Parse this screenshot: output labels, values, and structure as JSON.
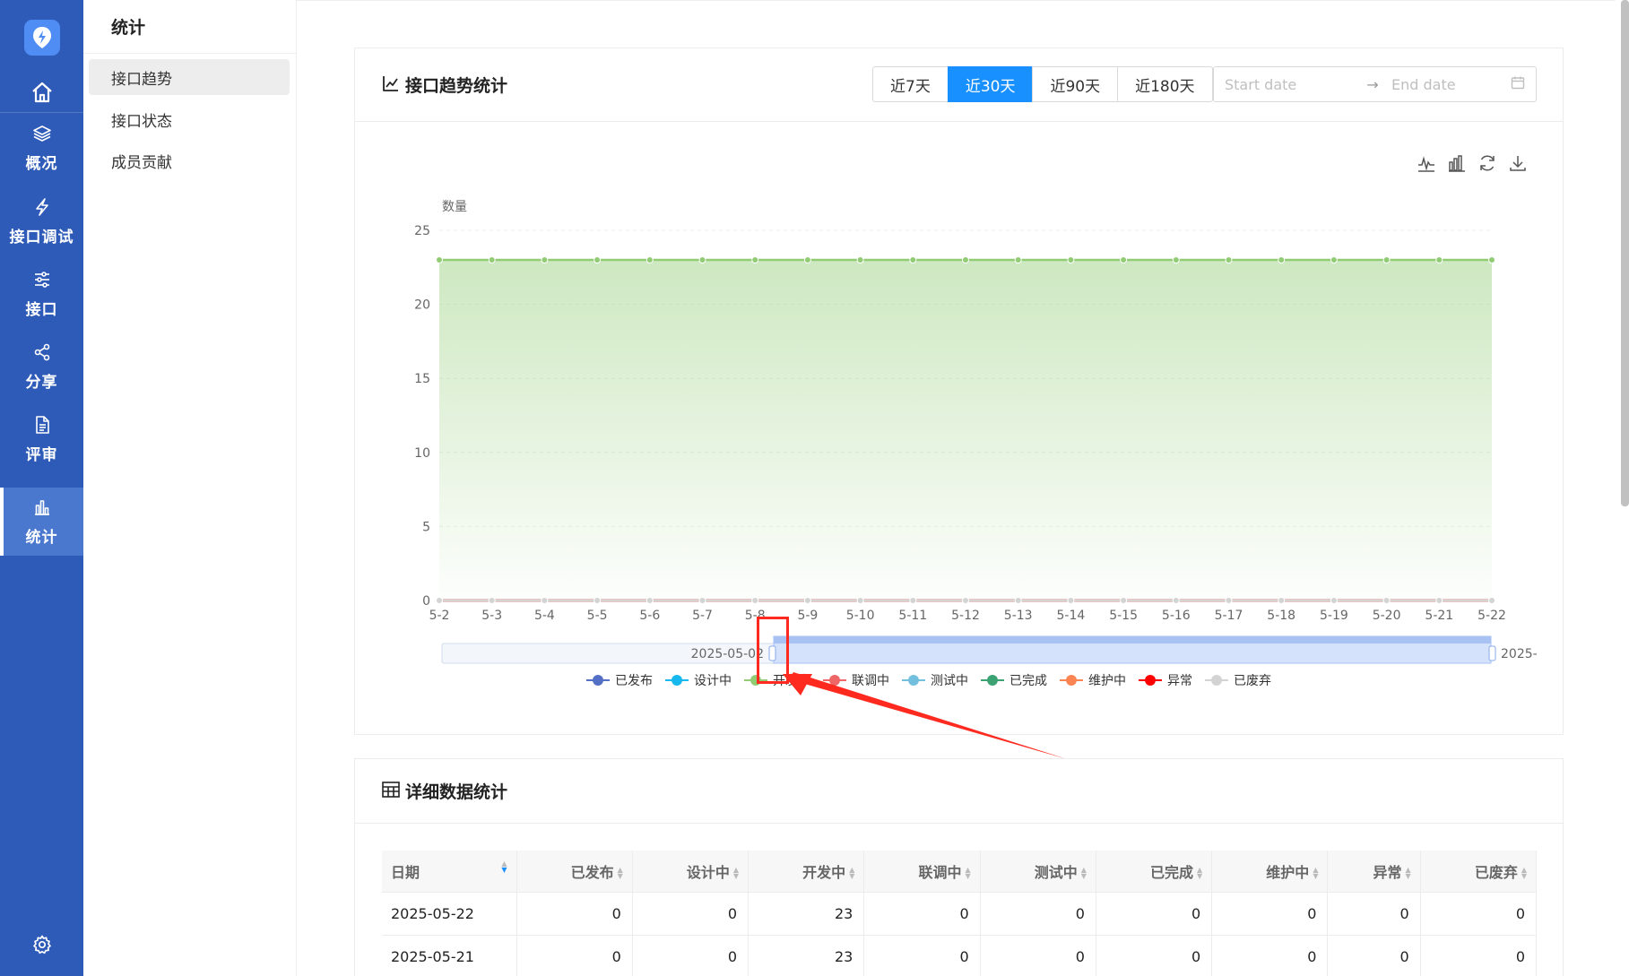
{
  "rail": {
    "items": [
      {
        "label": "概况",
        "icon": "layers-icon"
      },
      {
        "label": "接口调试",
        "icon": "lightning-icon"
      },
      {
        "label": "接口",
        "icon": "sliders-icon"
      },
      {
        "label": "分享",
        "icon": "share-icon"
      },
      {
        "label": "评审",
        "icon": "document-icon"
      },
      {
        "label": "统计",
        "icon": "bar-chart-icon"
      }
    ],
    "active_index": 5
  },
  "subnav": {
    "title": "统计",
    "items": [
      {
        "label": "接口趋势"
      },
      {
        "label": "接口状态"
      },
      {
        "label": "成员贡献"
      }
    ],
    "active_index": 0
  },
  "trend": {
    "title": "接口趋势统计",
    "ranges": [
      "近7天",
      "近30天",
      "近90天",
      "近180天"
    ],
    "active_range_index": 1,
    "date_start_placeholder": "Start date",
    "date_end_placeholder": "End date",
    "date_arrow": "→",
    "zoom_start_label": "2025-05-02",
    "zoom_end_label": "2025-"
  },
  "chart_data": {
    "type": "line",
    "title": "",
    "xlabel": "",
    "ylabel": "数量",
    "ylim": [
      0,
      25
    ],
    "yticks": [
      0,
      5,
      10,
      15,
      20,
      25
    ],
    "grid": true,
    "legend": "bottom",
    "categories": [
      "5-2",
      "5-3",
      "5-4",
      "5-5",
      "5-6",
      "5-7",
      "5-8",
      "5-9",
      "5-10",
      "5-11",
      "5-12",
      "5-13",
      "5-14",
      "5-15",
      "5-16",
      "5-17",
      "5-18",
      "5-19",
      "5-20",
      "5-21",
      "5-22"
    ],
    "series": [
      {
        "name": "已发布",
        "color": "#5470c6",
        "values": [
          0,
          0,
          0,
          0,
          0,
          0,
          0,
          0,
          0,
          0,
          0,
          0,
          0,
          0,
          0,
          0,
          0,
          0,
          0,
          0,
          0
        ]
      },
      {
        "name": "设计中",
        "color": "#16b8f0",
        "values": [
          0,
          0,
          0,
          0,
          0,
          0,
          0,
          0,
          0,
          0,
          0,
          0,
          0,
          0,
          0,
          0,
          0,
          0,
          0,
          0,
          0
        ]
      },
      {
        "name": "开发中",
        "color": "#91cc75",
        "area": true,
        "values": [
          23,
          23,
          23,
          23,
          23,
          23,
          23,
          23,
          23,
          23,
          23,
          23,
          23,
          23,
          23,
          23,
          23,
          23,
          23,
          23,
          23
        ]
      },
      {
        "name": "联调中",
        "color": "#ee6666",
        "values": [
          0,
          0,
          0,
          0,
          0,
          0,
          0,
          0,
          0,
          0,
          0,
          0,
          0,
          0,
          0,
          0,
          0,
          0,
          0,
          0,
          0
        ]
      },
      {
        "name": "测试中",
        "color": "#73c0de",
        "values": [
          0,
          0,
          0,
          0,
          0,
          0,
          0,
          0,
          0,
          0,
          0,
          0,
          0,
          0,
          0,
          0,
          0,
          0,
          0,
          0,
          0
        ]
      },
      {
        "name": "已完成",
        "color": "#3ba272",
        "values": [
          0,
          0,
          0,
          0,
          0,
          0,
          0,
          0,
          0,
          0,
          0,
          0,
          0,
          0,
          0,
          0,
          0,
          0,
          0,
          0,
          0
        ]
      },
      {
        "name": "维护中",
        "color": "#fc8452",
        "values": [
          0,
          0,
          0,
          0,
          0,
          0,
          0,
          0,
          0,
          0,
          0,
          0,
          0,
          0,
          0,
          0,
          0,
          0,
          0,
          0,
          0
        ]
      },
      {
        "name": "异常",
        "color": "#ff0000",
        "values": [
          0,
          0,
          0,
          0,
          0,
          0,
          0,
          0,
          0,
          0,
          0,
          0,
          0,
          0,
          0,
          0,
          0,
          0,
          0,
          0,
          0
        ]
      },
      {
        "name": "已废弃",
        "color": "#d3d3d3",
        "values": [
          0,
          0,
          0,
          0,
          0,
          0,
          0,
          0,
          0,
          0,
          0,
          0,
          0,
          0,
          0,
          0,
          0,
          0,
          0,
          0,
          0
        ]
      }
    ]
  },
  "detail": {
    "title": "详细数据统计",
    "columns": [
      "日期",
      "已发布",
      "设计中",
      "开发中",
      "联调中",
      "测试中",
      "已完成",
      "维护中",
      "异常",
      "已废弃"
    ],
    "rows": [
      [
        "2025-05-22",
        "0",
        "0",
        "23",
        "0",
        "0",
        "0",
        "0",
        "0",
        "0"
      ],
      [
        "2025-05-21",
        "0",
        "0",
        "23",
        "0",
        "0",
        "0",
        "0",
        "0",
        "0"
      ]
    ]
  },
  "colors": {
    "rail_bg": "#2e5bb8",
    "accent": "#1890ff",
    "annotation": "#ff2a1f"
  }
}
